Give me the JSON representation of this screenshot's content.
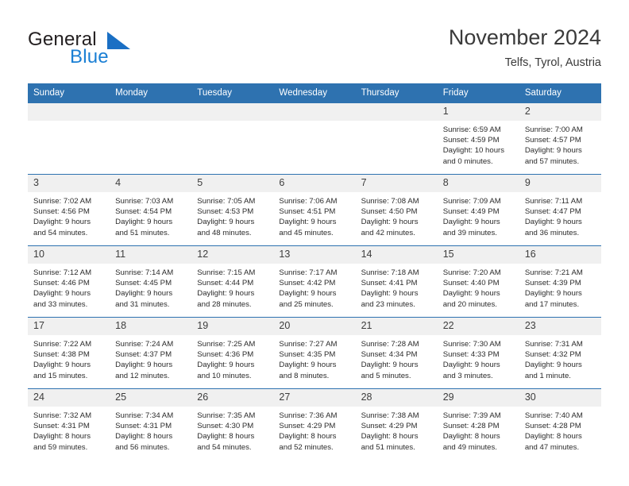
{
  "brand": {
    "word_top": "General",
    "word_bottom": "Blue",
    "mark_icon": "triangle-logo-icon",
    "mark_color": "#1a6fc4"
  },
  "header": {
    "title": "November 2024",
    "subtitle": "Telfs, Tyrol, Austria"
  },
  "theme": {
    "header_blue": "#2e72b0",
    "daynum_gray": "#f0f0f0",
    "brand_blue": "#1a7fd4"
  },
  "weekday_headers": [
    "Sunday",
    "Monday",
    "Tuesday",
    "Wednesday",
    "Thursday",
    "Friday",
    "Saturday"
  ],
  "weeks": [
    [
      {
        "day": "",
        "lines": []
      },
      {
        "day": "",
        "lines": []
      },
      {
        "day": "",
        "lines": []
      },
      {
        "day": "",
        "lines": []
      },
      {
        "day": "",
        "lines": []
      },
      {
        "day": "1",
        "lines": [
          "Sunrise: 6:59 AM",
          "Sunset: 4:59 PM",
          "Daylight: 10 hours",
          "and 0 minutes."
        ]
      },
      {
        "day": "2",
        "lines": [
          "Sunrise: 7:00 AM",
          "Sunset: 4:57 PM",
          "Daylight: 9 hours",
          "and 57 minutes."
        ]
      }
    ],
    [
      {
        "day": "3",
        "lines": [
          "Sunrise: 7:02 AM",
          "Sunset: 4:56 PM",
          "Daylight: 9 hours",
          "and 54 minutes."
        ]
      },
      {
        "day": "4",
        "lines": [
          "Sunrise: 7:03 AM",
          "Sunset: 4:54 PM",
          "Daylight: 9 hours",
          "and 51 minutes."
        ]
      },
      {
        "day": "5",
        "lines": [
          "Sunrise: 7:05 AM",
          "Sunset: 4:53 PM",
          "Daylight: 9 hours",
          "and 48 minutes."
        ]
      },
      {
        "day": "6",
        "lines": [
          "Sunrise: 7:06 AM",
          "Sunset: 4:51 PM",
          "Daylight: 9 hours",
          "and 45 minutes."
        ]
      },
      {
        "day": "7",
        "lines": [
          "Sunrise: 7:08 AM",
          "Sunset: 4:50 PM",
          "Daylight: 9 hours",
          "and 42 minutes."
        ]
      },
      {
        "day": "8",
        "lines": [
          "Sunrise: 7:09 AM",
          "Sunset: 4:49 PM",
          "Daylight: 9 hours",
          "and 39 minutes."
        ]
      },
      {
        "day": "9",
        "lines": [
          "Sunrise: 7:11 AM",
          "Sunset: 4:47 PM",
          "Daylight: 9 hours",
          "and 36 minutes."
        ]
      }
    ],
    [
      {
        "day": "10",
        "lines": [
          "Sunrise: 7:12 AM",
          "Sunset: 4:46 PM",
          "Daylight: 9 hours",
          "and 33 minutes."
        ]
      },
      {
        "day": "11",
        "lines": [
          "Sunrise: 7:14 AM",
          "Sunset: 4:45 PM",
          "Daylight: 9 hours",
          "and 31 minutes."
        ]
      },
      {
        "day": "12",
        "lines": [
          "Sunrise: 7:15 AM",
          "Sunset: 4:44 PM",
          "Daylight: 9 hours",
          "and 28 minutes."
        ]
      },
      {
        "day": "13",
        "lines": [
          "Sunrise: 7:17 AM",
          "Sunset: 4:42 PM",
          "Daylight: 9 hours",
          "and 25 minutes."
        ]
      },
      {
        "day": "14",
        "lines": [
          "Sunrise: 7:18 AM",
          "Sunset: 4:41 PM",
          "Daylight: 9 hours",
          "and 23 minutes."
        ]
      },
      {
        "day": "15",
        "lines": [
          "Sunrise: 7:20 AM",
          "Sunset: 4:40 PM",
          "Daylight: 9 hours",
          "and 20 minutes."
        ]
      },
      {
        "day": "16",
        "lines": [
          "Sunrise: 7:21 AM",
          "Sunset: 4:39 PM",
          "Daylight: 9 hours",
          "and 17 minutes."
        ]
      }
    ],
    [
      {
        "day": "17",
        "lines": [
          "Sunrise: 7:22 AM",
          "Sunset: 4:38 PM",
          "Daylight: 9 hours",
          "and 15 minutes."
        ]
      },
      {
        "day": "18",
        "lines": [
          "Sunrise: 7:24 AM",
          "Sunset: 4:37 PM",
          "Daylight: 9 hours",
          "and 12 minutes."
        ]
      },
      {
        "day": "19",
        "lines": [
          "Sunrise: 7:25 AM",
          "Sunset: 4:36 PM",
          "Daylight: 9 hours",
          "and 10 minutes."
        ]
      },
      {
        "day": "20",
        "lines": [
          "Sunrise: 7:27 AM",
          "Sunset: 4:35 PM",
          "Daylight: 9 hours",
          "and 8 minutes."
        ]
      },
      {
        "day": "21",
        "lines": [
          "Sunrise: 7:28 AM",
          "Sunset: 4:34 PM",
          "Daylight: 9 hours",
          "and 5 minutes."
        ]
      },
      {
        "day": "22",
        "lines": [
          "Sunrise: 7:30 AM",
          "Sunset: 4:33 PM",
          "Daylight: 9 hours",
          "and 3 minutes."
        ]
      },
      {
        "day": "23",
        "lines": [
          "Sunrise: 7:31 AM",
          "Sunset: 4:32 PM",
          "Daylight: 9 hours",
          "and 1 minute."
        ]
      }
    ],
    [
      {
        "day": "24",
        "lines": [
          "Sunrise: 7:32 AM",
          "Sunset: 4:31 PM",
          "Daylight: 8 hours",
          "and 59 minutes."
        ]
      },
      {
        "day": "25",
        "lines": [
          "Sunrise: 7:34 AM",
          "Sunset: 4:31 PM",
          "Daylight: 8 hours",
          "and 56 minutes."
        ]
      },
      {
        "day": "26",
        "lines": [
          "Sunrise: 7:35 AM",
          "Sunset: 4:30 PM",
          "Daylight: 8 hours",
          "and 54 minutes."
        ]
      },
      {
        "day": "27",
        "lines": [
          "Sunrise: 7:36 AM",
          "Sunset: 4:29 PM",
          "Daylight: 8 hours",
          "and 52 minutes."
        ]
      },
      {
        "day": "28",
        "lines": [
          "Sunrise: 7:38 AM",
          "Sunset: 4:29 PM",
          "Daylight: 8 hours",
          "and 51 minutes."
        ]
      },
      {
        "day": "29",
        "lines": [
          "Sunrise: 7:39 AM",
          "Sunset: 4:28 PM",
          "Daylight: 8 hours",
          "and 49 minutes."
        ]
      },
      {
        "day": "30",
        "lines": [
          "Sunrise: 7:40 AM",
          "Sunset: 4:28 PM",
          "Daylight: 8 hours",
          "and 47 minutes."
        ]
      }
    ]
  ]
}
